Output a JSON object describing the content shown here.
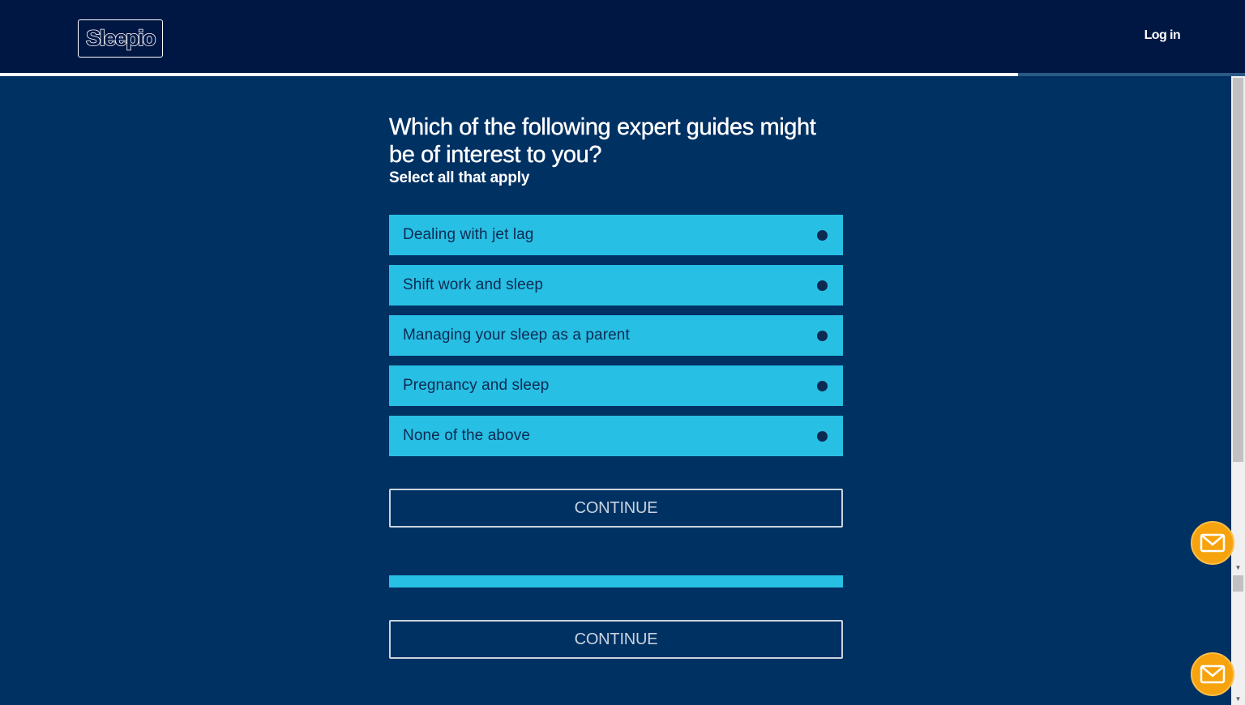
{
  "header": {
    "logo_text": "Sleepio",
    "login_label": "Log in"
  },
  "progress": {
    "fraction": 0.818
  },
  "question": {
    "title": "Which of the following expert guides might be of interest to you?",
    "subtitle": "Select all that apply"
  },
  "options": [
    {
      "label": "Dealing with jet lag"
    },
    {
      "label": "Shift work and sleep"
    },
    {
      "label": "Managing your sleep as a parent"
    },
    {
      "label": "Pregnancy and sleep"
    },
    {
      "label": "None of the above"
    }
  ],
  "buttons": {
    "continue_label": "CONTINUE",
    "continue_label_2": "CONTINUE"
  },
  "icons": {
    "chat": "mail-icon",
    "option_marker": "radio-dot-icon"
  },
  "colors": {
    "background": "#003163",
    "header": "#001744",
    "option": "#27bfe4",
    "chat": "#f7a30d"
  }
}
